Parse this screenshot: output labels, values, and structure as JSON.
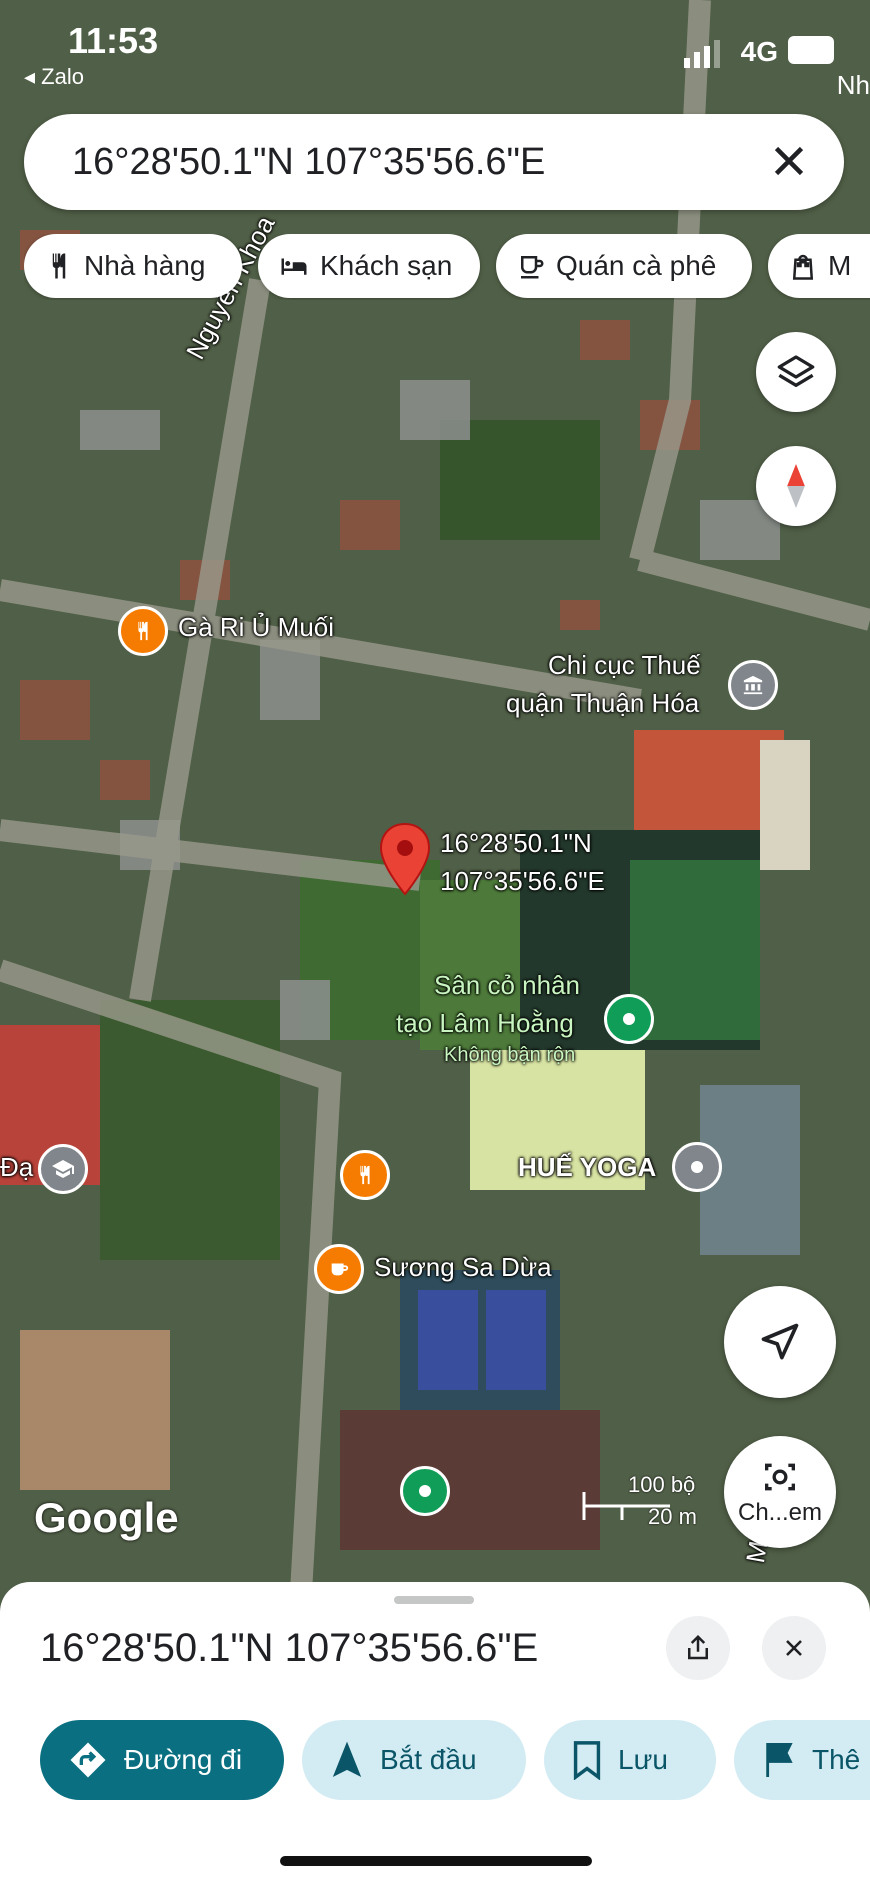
{
  "status_bar": {
    "time": "11:53",
    "back_app": "◂ Zalo",
    "network": "4G",
    "edge_text": "Nh"
  },
  "search": {
    "query": "16°28'50.1\"N 107°35'56.6\"E"
  },
  "chips": [
    {
      "label": "Nhà hàng",
      "icon": "fork-knife-icon"
    },
    {
      "label": "Khách sạn",
      "icon": "bed-icon"
    },
    {
      "label": "Quán cà phê",
      "icon": "coffee-icon"
    },
    {
      "label": "M",
      "icon": "shopping-bag-icon"
    }
  ],
  "map": {
    "streets": [
      "Nguyễn Khoa",
      "Mô"
    ],
    "places": [
      {
        "name": "Gà Ri Ủ Muối",
        "kind": "restaurant"
      },
      {
        "name": "Chi cục Thuế",
        "kind": "government"
      },
      {
        "name": "quận Thuận Hóa",
        "kind": "government"
      },
      {
        "name": "Sân cỏ nhân",
        "kind": "sports"
      },
      {
        "name": "tạo Lâm Hoằng",
        "kind": "sports"
      },
      {
        "name": "Không bận rộn",
        "kind": "status"
      },
      {
        "name": "HUẾ YOGA",
        "kind": "place"
      },
      {
        "name": "Sương Sa Dừa",
        "kind": "cafe"
      },
      {
        "name": "Đạ",
        "kind": "school"
      }
    ],
    "pin": {
      "line1": "16°28'50.1\"N",
      "line2": "107°35'56.6\"E"
    },
    "attribution": "Google",
    "scale": {
      "imperial": "100 bộ",
      "metric": "20 m"
    },
    "camera_button": "Ch...em"
  },
  "sheet": {
    "title": "16°28'50.1\"N 107°35'56.6\"E",
    "actions": [
      {
        "label": "Đường đi",
        "icon": "directions-icon"
      },
      {
        "label": "Bắt đầu",
        "icon": "navigation-arrow-icon"
      },
      {
        "label": "Lưu",
        "icon": "bookmark-icon"
      },
      {
        "label": "Thê",
        "icon": "flag-icon"
      }
    ]
  },
  "colors": {
    "primary": "#0a6f80",
    "tonal": "#d3ecf3",
    "pin": "#ea4335",
    "poi_orange": "#f57c00",
    "poi_green": "#0f9d58",
    "poi_gray": "#80868b"
  }
}
